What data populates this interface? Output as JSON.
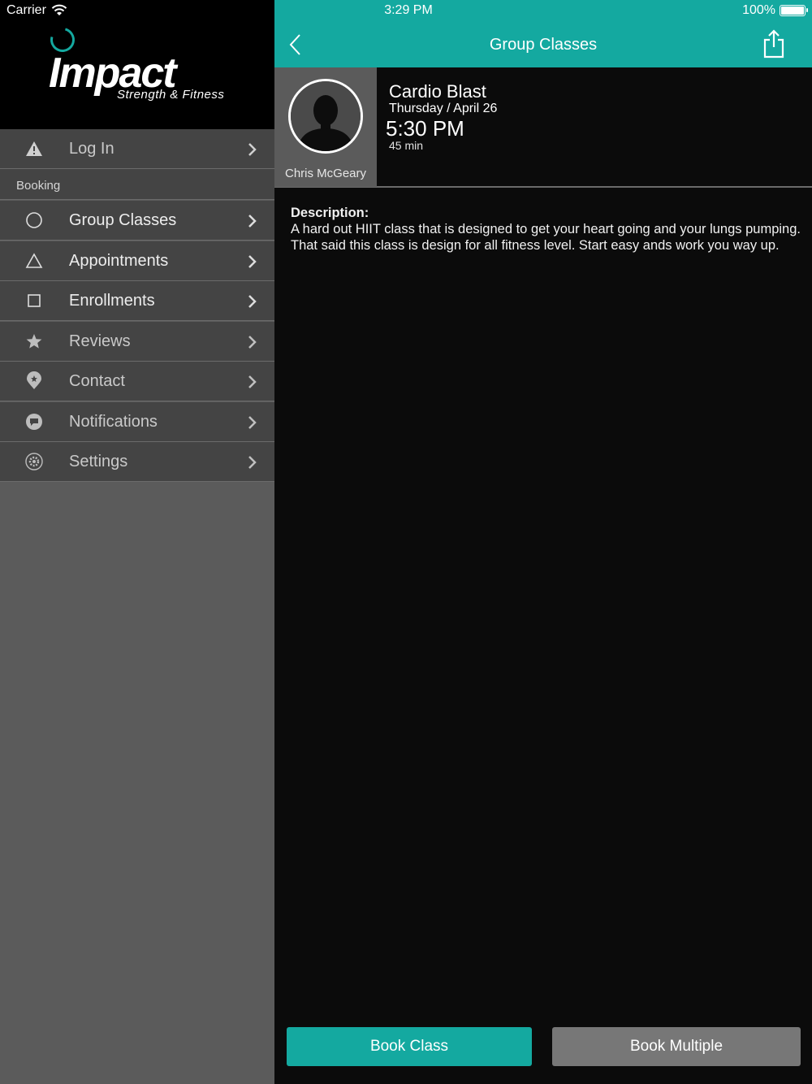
{
  "status_bar": {
    "carrier": "Carrier",
    "time": "3:29 PM",
    "battery": "100%"
  },
  "logo": {
    "word": "Impact",
    "subtitle": "Strength & Fitness"
  },
  "sidebar": {
    "login_label": "Log In",
    "section_booking": "Booking",
    "items": [
      {
        "label": "Group Classes",
        "icon": "circle-icon"
      },
      {
        "label": "Appointments",
        "icon": "triangle-icon"
      },
      {
        "label": "Enrollments",
        "icon": "square-icon"
      },
      {
        "label": "Reviews",
        "icon": "star-icon"
      },
      {
        "label": "Contact",
        "icon": "location-pin-icon"
      },
      {
        "label": "Notifications",
        "icon": "chat-bubble-icon"
      },
      {
        "label": "Settings",
        "icon": "gear-icon"
      }
    ]
  },
  "navbar": {
    "title": "Group Classes"
  },
  "class": {
    "name": "Cardio Blast",
    "date": "Thursday / April 26",
    "time": "5:30 PM",
    "duration": "45 min",
    "instructor": "Chris McGeary",
    "description_label": "Description:",
    "description": "A hard out HIIT class that is designed to get your heart going and your lungs pumping.  That said this class is design for all fitness level.  Start easy ands work you way up."
  },
  "actions": {
    "book_class": "Book Class",
    "book_multiple": "Book Multiple"
  },
  "colors": {
    "accent": "#14a9a0",
    "sidebar_bg": "#5b5b5b",
    "menu_bg": "#444444",
    "main_bg": "#0b0b0b"
  }
}
